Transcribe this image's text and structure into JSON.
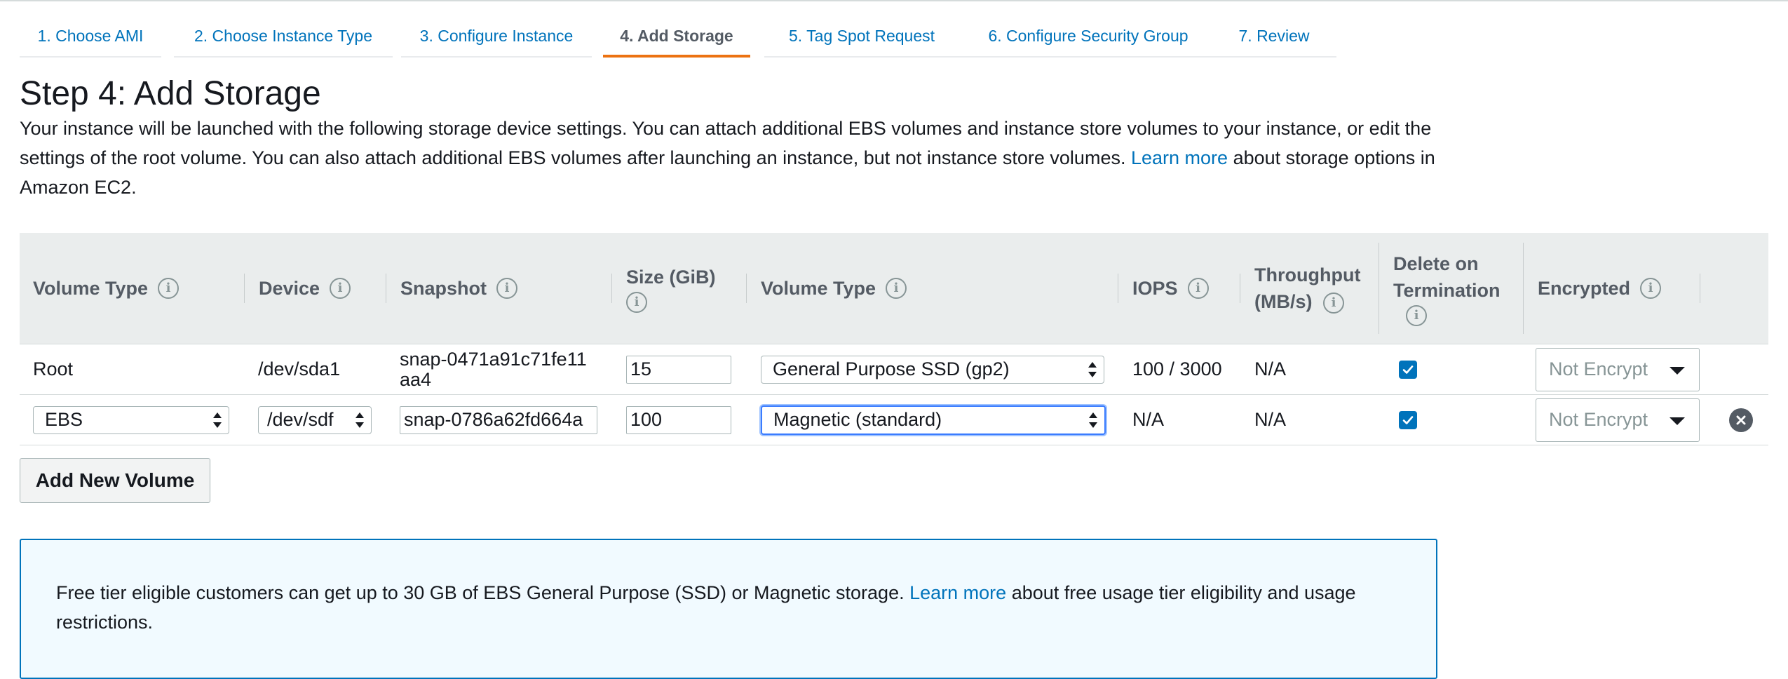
{
  "tabs": [
    {
      "label": "1. Choose AMI"
    },
    {
      "label": "2. Choose Instance Type"
    },
    {
      "label": "3. Configure Instance"
    },
    {
      "label": "4. Add Storage"
    },
    {
      "label": "5. Tag Spot Request"
    },
    {
      "label": "6. Configure Security Group"
    },
    {
      "label": "7. Review"
    }
  ],
  "active_tab": "4. Add Storage",
  "page": {
    "title": "Step 4: Add Storage",
    "desc_1": "Your instance will be launched with the following storage device settings. You can attach additional EBS volumes and instance store volumes to your instance, or edit the settings of the root volume. You can also attach additional EBS volumes after launching an instance, but not instance store volumes.",
    "desc_link": "Learn more",
    "desc_2": "about storage options in Amazon EC2."
  },
  "table": {
    "headers": {
      "volume_type": "Volume Type",
      "device": "Device",
      "snapshot": "Snapshot",
      "size": "Size (GiB)",
      "volume_type_2": "Volume Type",
      "iops": "IOPS",
      "throughput": "Throughput (MB/s)",
      "delete": "Delete on Termination",
      "encrypted": "Encrypted"
    },
    "info_glyph": "i",
    "rows": [
      {
        "volume_type": "Root",
        "device": "/dev/sda1",
        "snapshot": "snap-0471a91c71fe11aa4",
        "size": "15",
        "ebs_type": "General Purpose SSD (gp2)",
        "iops": "100 / 3000",
        "throughput": "N/A",
        "delete_on_termination": true,
        "encrypted": "Not Encrypt"
      },
      {
        "volume_type": "EBS",
        "device": "/dev/sdf",
        "snapshot": "snap-0786a62fd664a",
        "size": "100",
        "ebs_type": "Magnetic (standard)",
        "iops": "N/A",
        "throughput": "N/A",
        "delete_on_termination": true,
        "encrypted": "Not Encrypt"
      }
    ]
  },
  "add_button": "Add New Volume",
  "notice": {
    "text_1": "Free tier eligible customers can get up to 30 GB of EBS General Purpose (SSD) or Magnetic storage.",
    "link": "Learn more",
    "text_2": "about free usage tier eligibility and usage restrictions."
  },
  "colors": {
    "link": "#0073bb",
    "active_tab_underline": "#ec7211",
    "table_header_bg": "#eaeded",
    "notice_bg": "#f1faff",
    "checkbox": "#0073bb"
  }
}
